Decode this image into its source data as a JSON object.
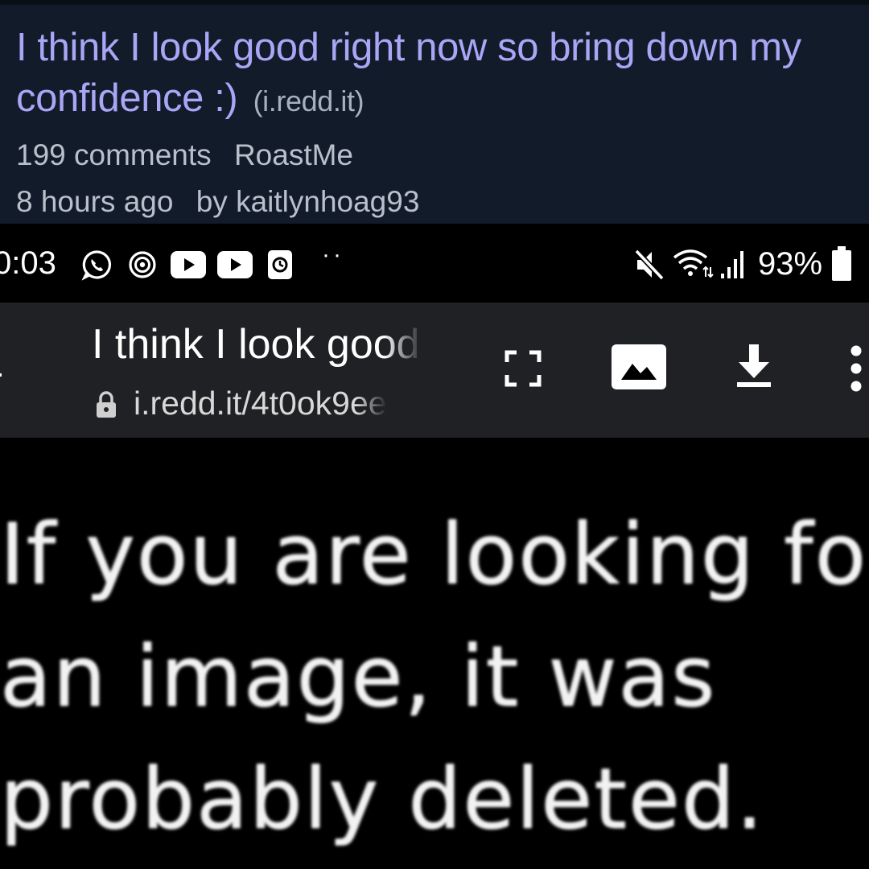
{
  "post": {
    "title": "I think I look good right now so bring down my confidence :)",
    "domain": "(i.redd.it)",
    "comments": "199 comments",
    "subreddit": "RoastMe",
    "age": "8 hours ago",
    "author": "by kaitlynhoag93",
    "colors": {
      "background": "#121b2a",
      "title": "#a9a6f6",
      "meta": "#b9c0cb"
    }
  },
  "status_bar": {
    "time": "0:03",
    "notification_icons": [
      "whatsapp-icon",
      "threads-icon",
      "youtube-icon",
      "youtube-icon",
      "clock-app-icon"
    ],
    "overflow": "··",
    "right_icons": [
      "mute-icon",
      "wifi-icon",
      "signal-icon",
      "battery-icon"
    ],
    "battery": "93%"
  },
  "browser": {
    "back_icon": "back-arrow-icon",
    "page_title": "I think I look good right now so bring down my confidence :)",
    "url": "i.redd.it/4t0ok9ee",
    "lock_icon": "lock-icon",
    "actions": [
      "fullscreen-icon",
      "image-icon",
      "download-icon",
      "more-vert-icon"
    ],
    "background": "#202124"
  },
  "content": {
    "lines": [
      "If you are looking for",
      "an image, it was",
      "probably deleted."
    ]
  }
}
